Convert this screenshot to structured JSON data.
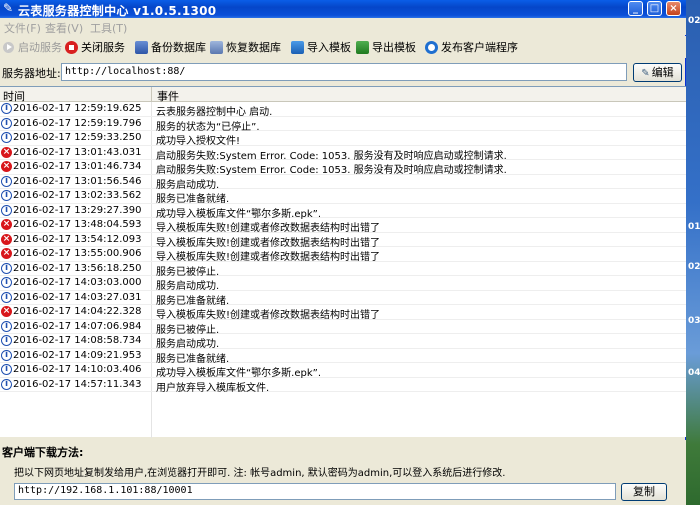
{
  "window": {
    "title": "云表服务器控制中心 v1.0.5.1300",
    "min": "_",
    "max": "□",
    "close": "×"
  },
  "menu": [
    "文件(F)",
    "查看(V)",
    "工具(T)"
  ],
  "toolbar": {
    "start": "启动服务",
    "stop": "关闭服务",
    "backup": "备份数据库",
    "restore": "恢复数据库",
    "import": "导入模板",
    "export": "导出模板",
    "publish": "发布客户端程序"
  },
  "server": {
    "label": "服务器地址:",
    "address": "http://localhost:88/",
    "edit": "编辑"
  },
  "log": {
    "col_time": "时间",
    "col_event": "事件",
    "rows": [
      {
        "type": "info",
        "time": "2016-02-17 12:59:19.625",
        "event": "云表服务器控制中心 启动."
      },
      {
        "type": "info",
        "time": "2016-02-17 12:59:19.796",
        "event": "服务的状态为“已停止”."
      },
      {
        "type": "info",
        "time": "2016-02-17 12:59:33.250",
        "event": "成功导入授权文件!"
      },
      {
        "type": "error",
        "time": "2016-02-17 13:01:43.031",
        "event": "启动服务失败:System Error.  Code: 1053. 服务没有及时响应启动或控制请求."
      },
      {
        "type": "error",
        "time": "2016-02-17 13:01:46.734",
        "event": "启动服务失败:System Error.  Code: 1053. 服务没有及时响应启动或控制请求."
      },
      {
        "type": "info",
        "time": "2016-02-17 13:01:56.546",
        "event": "服务启动成功."
      },
      {
        "type": "info",
        "time": "2016-02-17 13:02:33.562",
        "event": "服务已准备就绪."
      },
      {
        "type": "info",
        "time": "2016-02-17 13:29:27.390",
        "event": "成功导入模板库文件“鄂尔多斯.epk”."
      },
      {
        "type": "error",
        "time": "2016-02-17 13:48:04.593",
        "event": "导入模板库失败!创建或者修改数据表结构时出错了"
      },
      {
        "type": "error",
        "time": "2016-02-17 13:54:12.093",
        "event": "导入模板库失败!创建或者修改数据表结构时出错了"
      },
      {
        "type": "error",
        "time": "2016-02-17 13:55:00.906",
        "event": "导入模板库失败!创建或者修改数据表结构时出错了"
      },
      {
        "type": "info",
        "time": "2016-02-17 13:56:18.250",
        "event": "服务已被停止."
      },
      {
        "type": "info",
        "time": "2016-02-17 14:03:03.000",
        "event": "服务启动成功."
      },
      {
        "type": "info",
        "time": "2016-02-17 14:03:27.031",
        "event": "服务已准备就绪."
      },
      {
        "type": "error",
        "time": "2016-02-17 14:04:22.328",
        "event": "导入模板库失败!创建或者修改数据表结构时出错了"
      },
      {
        "type": "info",
        "time": "2016-02-17 14:07:06.984",
        "event": "服务已被停止."
      },
      {
        "type": "info",
        "time": "2016-02-17 14:08:58.734",
        "event": "服务启动成功."
      },
      {
        "type": "info",
        "time": "2016-02-17 14:09:21.953",
        "event": "服务已准备就绪."
      },
      {
        "type": "info",
        "time": "2016-02-17 14:10:03.406",
        "event": "成功导入模板库文件“鄂尔多斯.epk”."
      },
      {
        "type": "info",
        "time": "2016-02-17 14:57:11.343",
        "event": "用户放弃导入模库板文件."
      }
    ]
  },
  "download": {
    "title": "客户端下载方法:",
    "note": "把以下网页地址复制发给用户,在浏览器打开即可.    注: 帐号admin, 默认密码为admin,可以登入系统后进行修改.",
    "url": "http://192.168.1.101:88/10001",
    "copy": "复制"
  },
  "desktop_edge": [
    "02",
    "01",
    "02",
    "03",
    "04"
  ],
  "colors": {
    "info": "#2050b0",
    "error": "#d8161b",
    "titlebar": "#0546c9"
  }
}
